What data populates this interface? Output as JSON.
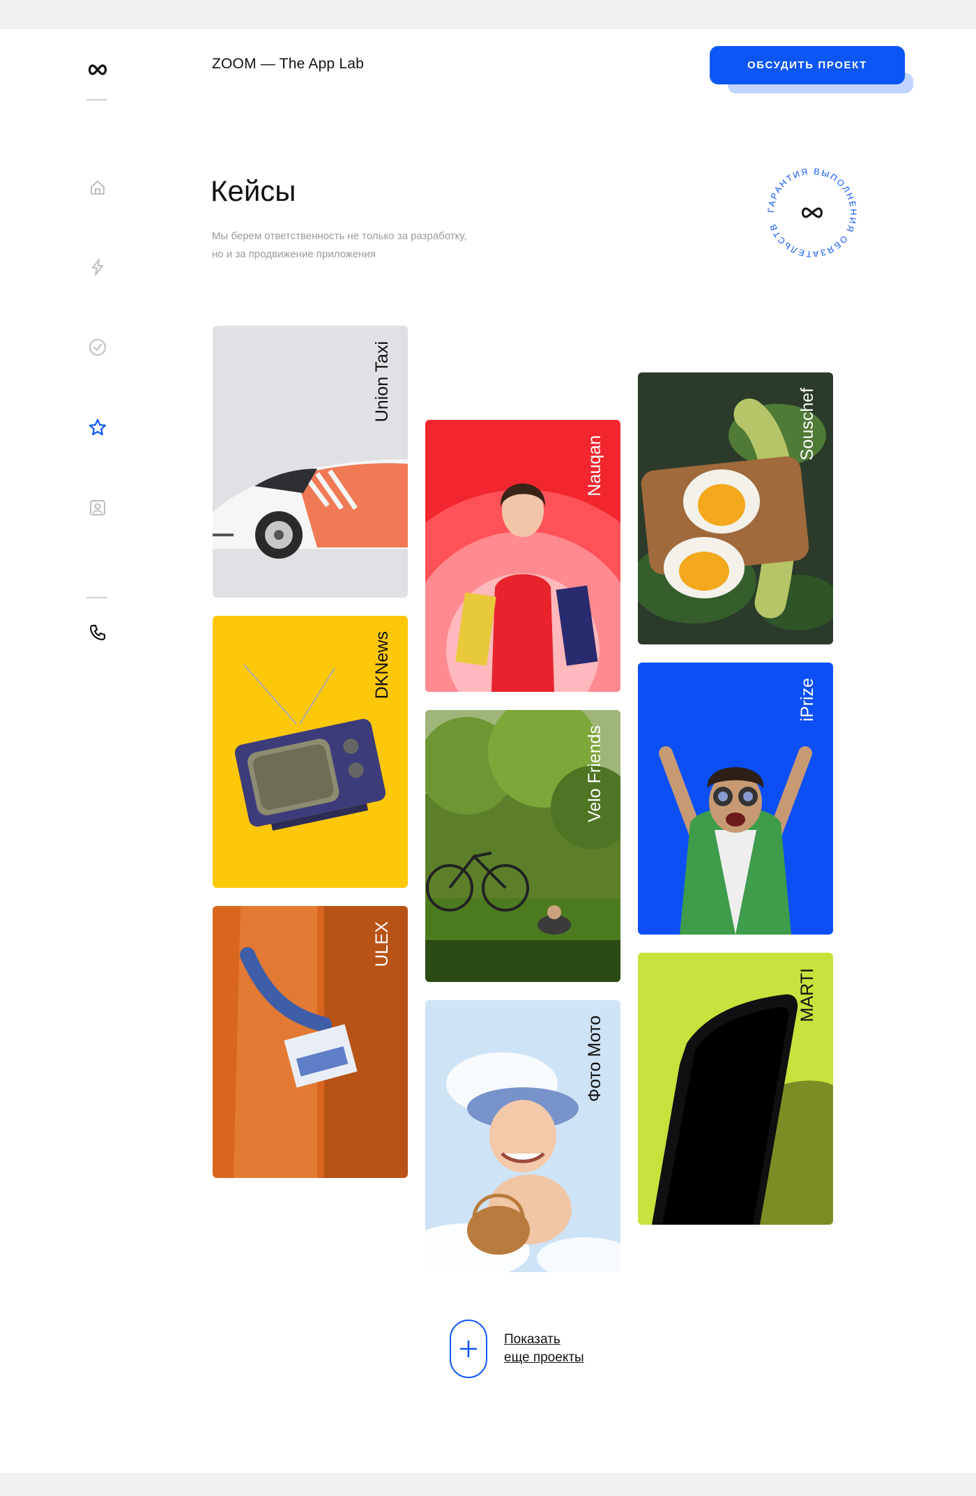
{
  "header": {
    "brand": "ZOOM — The App Lab",
    "cta_label": "ОБСУДИТЬ ПРОЕКТ"
  },
  "sidebar": {
    "items": [
      {
        "icon": "home-icon",
        "active": false
      },
      {
        "icon": "lightning-icon",
        "active": false
      },
      {
        "icon": "check-circle-icon",
        "active": false
      },
      {
        "icon": "star-icon",
        "active": true
      },
      {
        "icon": "contact-card-icon",
        "active": false
      }
    ],
    "bottom_icon": "phone-icon"
  },
  "main": {
    "title": "Кейсы",
    "subtitle_line1": "Мы берем ответственность не только за разработку,",
    "subtitle_line2": "но и за продвижение приложения",
    "badge_text": "ГАРАНТИЯ ВЫПОЛНЕНИЯ ОБЯЗАТЕЛЬСТВ"
  },
  "cases": [
    {
      "name": "Union Taxi",
      "bg": "#e1e1e5",
      "text_color": "#111111"
    },
    {
      "name": "DKNews",
      "bg": "#fec80a",
      "text_color": "#111111"
    },
    {
      "name": "ULEX",
      "bg": "#d9651e",
      "text_color": "#ffffff"
    },
    {
      "name": "Nauqan",
      "bg": "#f2262e",
      "text_color": "#ffffff"
    },
    {
      "name": "Velo Friends",
      "bg": "#5d7f2a",
      "text_color": "#ffffff"
    },
    {
      "name": "Фото Мото",
      "bg": "#cfe3f7",
      "text_color": "#111111"
    },
    {
      "name": "Souschef",
      "bg": "#2b3a2a",
      "text_color": "#ffffff"
    },
    {
      "name": "iPrize",
      "bg": "#0b4ff5",
      "text_color": "#ffffff"
    },
    {
      "name": "MARTI",
      "bg": "#c5e33c",
      "text_color": "#111111"
    }
  ],
  "show_more": {
    "line1": "Показать",
    "line2": "еще проекты"
  },
  "colors": {
    "accent": "#0b56f5",
    "muted_text": "#9a9a9a",
    "sidebar_icon": "#bdbdbd"
  }
}
